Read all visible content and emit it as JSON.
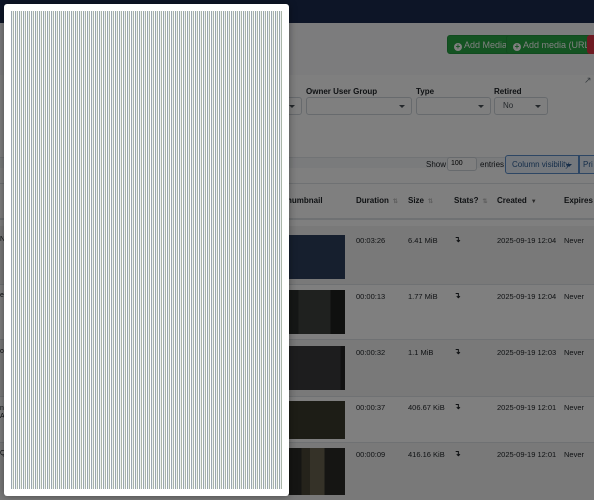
{
  "toolbar": {
    "add_media_label": "Add Media",
    "add_media_url_label": "Add media (URL)",
    "link_icon": "external-link-icon"
  },
  "filters": {
    "owner_group_label": "Owner User Group",
    "type_label": "Type",
    "retired_label": "Retired",
    "retired_value": "No"
  },
  "table_controls": {
    "show_label": "Show",
    "entries_value": "100",
    "entries_label": "entries",
    "column_visibility_label": "Column visibility",
    "print_label": "Pri"
  },
  "table": {
    "columns": [
      "humbnail",
      "Duration",
      "Size",
      "Stats?",
      "Created",
      "Expires"
    ],
    "rows": [
      {
        "edge": "N",
        "duration": "00:03:26",
        "size": "6.41 MiB",
        "stats": "↴",
        "created": "2025-09-19 12:04",
        "expires": "Never"
      },
      {
        "edge": "e",
        "duration": "00:00:13",
        "size": "1.77 MiB",
        "stats": "↴",
        "created": "2025-09-19 12:04",
        "expires": "Never"
      },
      {
        "edge": "o",
        "duration": "00:00:32",
        "size": "1.1 MiB",
        "stats": "↴",
        "created": "2025-09-19 12:03",
        "expires": "Never"
      },
      {
        "edge": "n",
        "edge2": "A",
        "duration": "00:00:37",
        "size": "406.67 KiB",
        "stats": "↴",
        "created": "2025-09-19 12:01",
        "expires": "Never"
      },
      {
        "edge": "Q",
        "duration": "00:00:09",
        "size": "416.16 KiB",
        "stats": "↴",
        "created": "2025-09-19 12:01",
        "expires": "Never"
      }
    ]
  },
  "colors": {
    "topbar": "#1b2a4e",
    "success": "#28a745",
    "danger": "#dc3545",
    "thumbnails": [
      "#2c3e5c",
      "#2b2e2c",
      "#3a3a3c",
      "#3a3a2c",
      "#4a4636"
    ]
  }
}
